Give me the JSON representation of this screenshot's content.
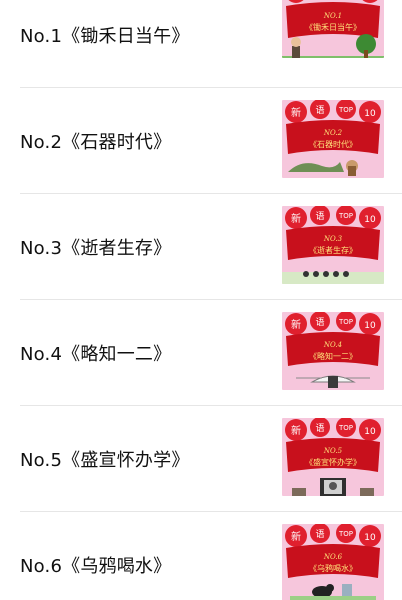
{
  "items": [
    {
      "title": "No.1《锄禾日当午》",
      "banner_no": "NO.1",
      "banner_title": "《锄禾日当午》"
    },
    {
      "title": "No.2《石器时代》",
      "banner_no": "NO.2",
      "banner_title": "《石器时代》"
    },
    {
      "title": "No.3《逝者生存》",
      "banner_no": "NO.3",
      "banner_title": "《逝者生存》"
    },
    {
      "title": "No.4《略知一二》",
      "banner_no": "NO.4",
      "banner_title": "《略知一二》"
    },
    {
      "title": "No.5《盛宣怀办学》",
      "banner_no": "NO.5",
      "banner_title": "《盛宣怀办学》"
    },
    {
      "title": "No.6《乌鸦喝水》",
      "banner_no": "NO.6",
      "banner_title": "《乌鸦喝水》"
    }
  ],
  "thumb_badges": [
    "新",
    "语",
    "TOP",
    "10"
  ],
  "colors": {
    "thumb_background": "#f6c6dc",
    "heart": "#e0202e",
    "ribbon": "#c8101c",
    "banner_text": "#ffe27a",
    "divider": "#e6e6e6"
  }
}
